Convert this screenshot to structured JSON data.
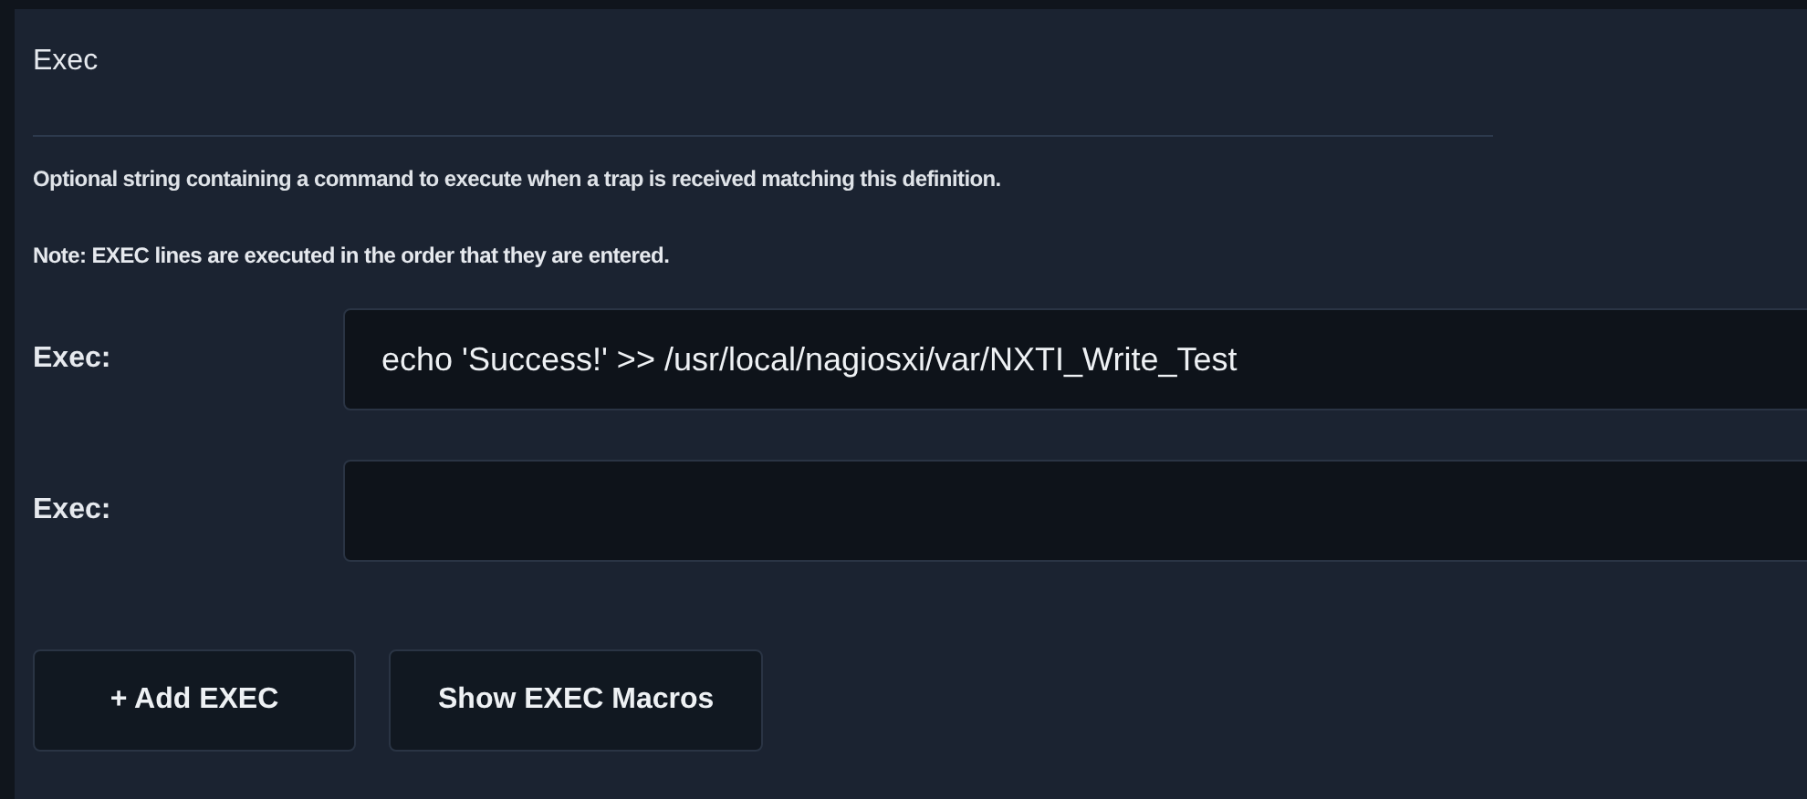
{
  "section": {
    "title": "Exec",
    "description": "Optional string containing a command to execute when a trap is received matching this definition.",
    "note": "Note: EXEC lines are executed in the order that they are entered."
  },
  "fields": [
    {
      "label": "Exec:",
      "value": "echo 'Success!' >> /usr/local/nagiosxi/var/NXTI_Write_Test"
    },
    {
      "label": "Exec:"
    }
  ],
  "buttons": [
    "+ Add EXEC",
    "Show EXEC Macros"
  ]
}
